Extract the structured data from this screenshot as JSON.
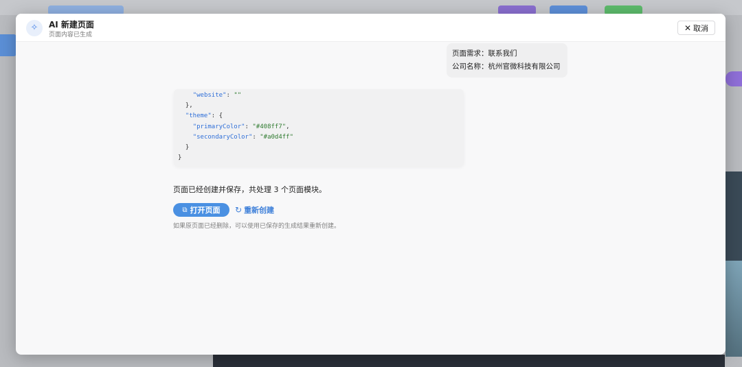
{
  "dialog": {
    "title": "AI 新建页面",
    "subtitle": "页面内容已生成",
    "cancel_label": "取消"
  },
  "request": {
    "line1": "页面需求：联系我们",
    "line2": "公司名称：杭州官微科技有限公司"
  },
  "code": {
    "lines": [
      {
        "indent": "    ",
        "key": "\"website\"",
        "sep": ": ",
        "val": "\"\"",
        "tail": ""
      },
      {
        "indent": "  ",
        "key": "",
        "sep": "",
        "val": "",
        "tail": "},"
      },
      {
        "indent": "  ",
        "key": "\"theme\"",
        "sep": ": {",
        "val": "",
        "tail": ""
      },
      {
        "indent": "    ",
        "key": "\"primaryColor\"",
        "sep": ": ",
        "val": "\"#408ff7\"",
        "tail": ","
      },
      {
        "indent": "    ",
        "key": "\"secondaryColor\"",
        "sep": ": ",
        "val": "\"#a0d4ff\"",
        "tail": ""
      },
      {
        "indent": "  ",
        "key": "",
        "sep": "",
        "val": "",
        "tail": "}"
      },
      {
        "indent": "",
        "key": "",
        "sep": "",
        "val": "",
        "tail": "}"
      }
    ]
  },
  "result": {
    "message": "页面已经创建并保存，共处理 3 个页面模块。",
    "open_label": "打开页面",
    "recreate_label": "重新创建",
    "hint": "如果原页面已经删除，可以使用已保存的生成结果重新创建。"
  },
  "icons": {
    "ai": "sparkle-icon",
    "close": "close-icon",
    "external": "external-link-icon",
    "refresh": "refresh-icon"
  },
  "colors": {
    "accent": "#4a90e2",
    "link": "#3d7fd9"
  }
}
